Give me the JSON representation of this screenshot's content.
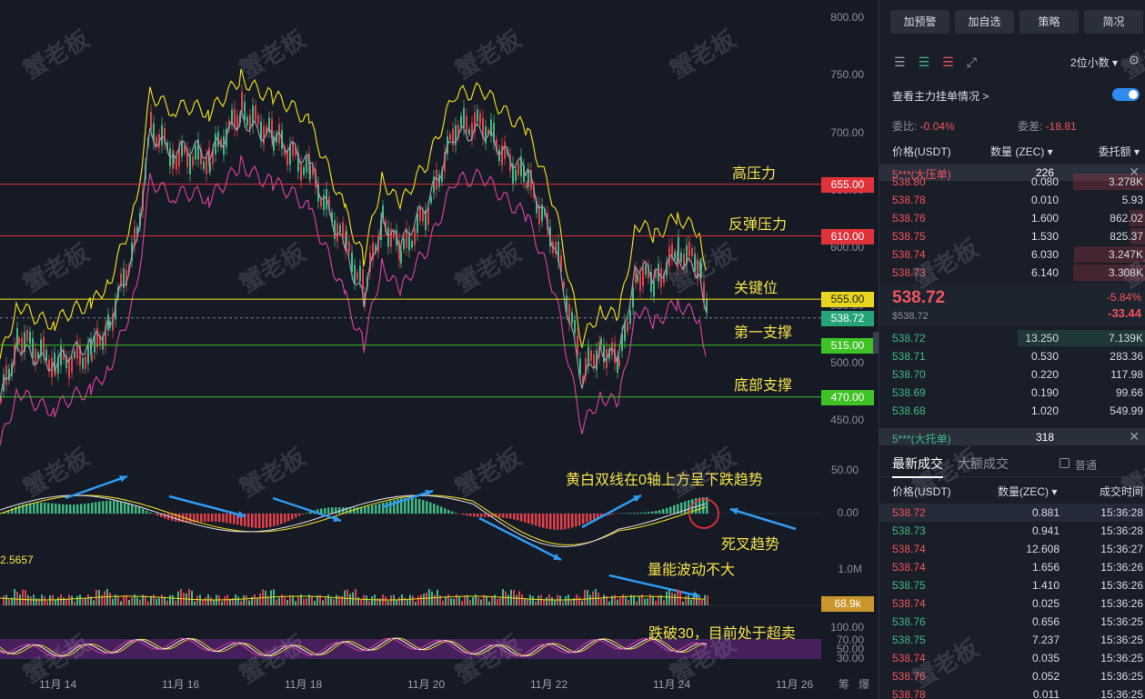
{
  "chart": {
    "price_ticks": [
      "800.00",
      "750.00",
      "700.00",
      "650.00",
      "600.00",
      "550.00",
      "500.00",
      "450.00"
    ],
    "levels": [
      {
        "price": 655,
        "label": "655.00",
        "color": "#e0323a",
        "line": "#e0323a",
        "annotation": "高压力"
      },
      {
        "price": 610,
        "label": "610.00",
        "color": "#e0323a",
        "line": "#e0323a",
        "annotation": "反弹压力"
      },
      {
        "price": 555,
        "label": "555.00",
        "color": "#e8d520",
        "line": "#e8d520",
        "annotation": "关键位"
      },
      {
        "price": 538.72,
        "label": "538.72",
        "color": "#27a37a",
        "line": "#7a8090",
        "annotation": "第一支撑"
      },
      {
        "price": 515,
        "label": "515.00",
        "color": "#3ec226",
        "line": "#3ec226",
        "annotation": "底部支撑"
      },
      {
        "price": 470,
        "label": "470.00",
        "color": "#3ec226",
        "line": "#3ec226",
        "annotation": ""
      }
    ],
    "macd_ticks": [
      "50.00",
      "0.00"
    ],
    "macd_annotation": "黄白双线在0轴上方呈下跌趋势",
    "macd_cross": "死叉趋势",
    "volume_value_left": "2.5657",
    "volume_tick": "1.0M",
    "volume_current": "68.9k",
    "volume_annotation": "量能波动不大",
    "rsi_ticks": [
      "100.00",
      "70.00",
      "50.00",
      "30.00"
    ],
    "rsi_annotation": "跌破30，目前处于超卖",
    "date_ticks": [
      "11月 14",
      "11月 16",
      "11月 18",
      "11月 20",
      "11月 22",
      "11月 24",
      "11月 26"
    ],
    "corner_labels": [
      "筹",
      "爆"
    ],
    "watermark": "蟹老板"
  },
  "panel": {
    "buttons": [
      "加预警",
      "加自选",
      "策略",
      "简况"
    ],
    "decimals": "2位小数 ▾",
    "toggle_label": "查看主力挂单情况 >",
    "ratio_label": "委比:",
    "ratio_value": "-0.04%",
    "diff_label": "委差:",
    "diff_value": "-18.81",
    "ob_headers": {
      "price": "价格(USDT)",
      "qty": "数量 (ZEC) ▾",
      "total": "委托额 ▾"
    },
    "big_ask": {
      "name": "5***(大压单)",
      "qty": "226"
    },
    "asks": [
      {
        "p": "538.80",
        "a": "0.080",
        "t": "3.278K"
      },
      {
        "p": "538.78",
        "a": "0.010",
        "t": "5.93"
      },
      {
        "p": "538.76",
        "a": "1.600",
        "t": "862.02"
      },
      {
        "p": "538.75",
        "a": "1.530",
        "t": "825.37"
      },
      {
        "p": "538.74",
        "a": "6.030",
        "t": "3.247K"
      },
      {
        "p": "538.73",
        "a": "6.140",
        "t": "3.308K"
      }
    ],
    "last_price": "538.72",
    "last_price_usd": "$538.72",
    "change_pct": "-5.84%",
    "change_abs": "-33.44",
    "bids": [
      {
        "p": "538.72",
        "a": "13.250",
        "t": "7.139K"
      },
      {
        "p": "538.71",
        "a": "0.530",
        "t": "283.36"
      },
      {
        "p": "538.70",
        "a": "0.220",
        "t": "117.98"
      },
      {
        "p": "538.69",
        "a": "0.190",
        "t": "99.66"
      },
      {
        "p": "538.68",
        "a": "1.020",
        "t": "549.99"
      }
    ],
    "big_bid": {
      "name": "5***(大托单)",
      "qty": "318"
    },
    "trade_tabs": [
      "最新成交",
      "大额成交"
    ],
    "normal_label": "普通",
    "trade_headers": {
      "price": "价格(USDT)",
      "qty": "数量(ZEC) ▾",
      "time": "成交时间"
    },
    "trades": [
      {
        "p": "538.72",
        "a": "0.881",
        "t": "15:36:28",
        "side": "red"
      },
      {
        "p": "538.73",
        "a": "0.941",
        "t": "15:36:28",
        "side": "green"
      },
      {
        "p": "538.74",
        "a": "12.608",
        "t": "15:36:27",
        "side": "red"
      },
      {
        "p": "538.74",
        "a": "1.656",
        "t": "15:36:26",
        "side": "red"
      },
      {
        "p": "538.75",
        "a": "1.410",
        "t": "15:36:26",
        "side": "green"
      },
      {
        "p": "538.74",
        "a": "0.025",
        "t": "15:36:26",
        "side": "red"
      },
      {
        "p": "538.76",
        "a": "0.656",
        "t": "15:36:25",
        "side": "green"
      },
      {
        "p": "538.75",
        "a": "7.237",
        "t": "15:36:25",
        "side": "green"
      },
      {
        "p": "538.74",
        "a": "0.035",
        "t": "15:36:25",
        "side": "red"
      },
      {
        "p": "538.76",
        "a": "0.052",
        "t": "15:36:25",
        "side": "red"
      },
      {
        "p": "538.78",
        "a": "0.011",
        "t": "15:36:25",
        "side": "red"
      }
    ]
  }
}
